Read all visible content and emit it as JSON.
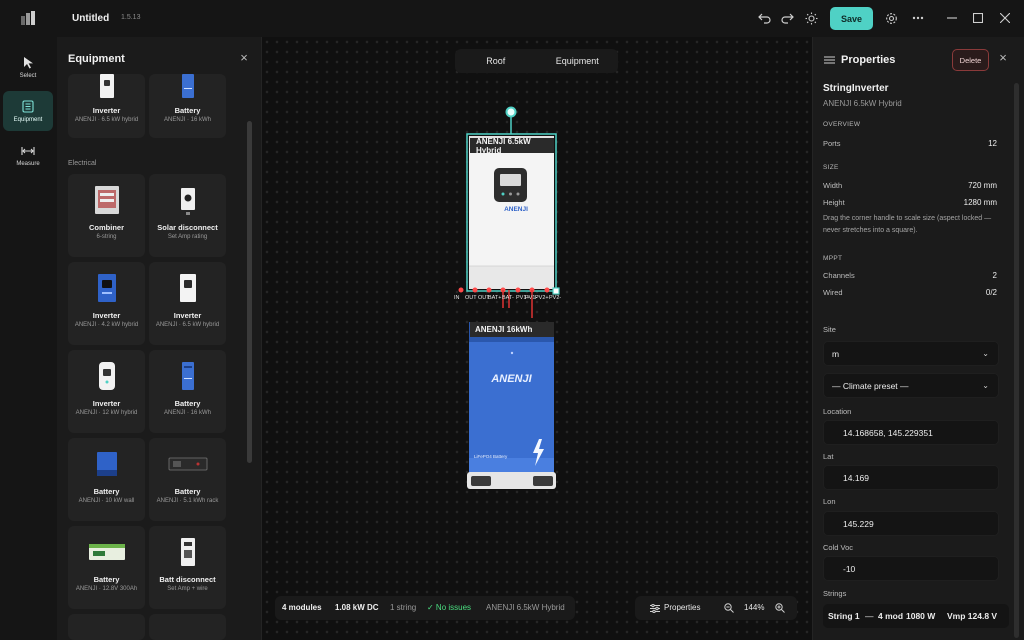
{
  "titlebar": {
    "title": "Untitled",
    "version": "1.5.13",
    "save_label": "Save"
  },
  "rail": [
    {
      "label": "Select",
      "icon": "cursor-icon"
    },
    {
      "label": "Equipment",
      "icon": "equipment-icon"
    },
    {
      "label": "Measure",
      "icon": "measure-icon"
    }
  ],
  "equipment": {
    "title": "Equipment",
    "section_electrical": "Electrical",
    "cards": [
      {
        "name": "Inverter",
        "sub": "ANENJI · 6.5 kW hybrid"
      },
      {
        "name": "Battery",
        "sub": "ANENJI · 16 kWh"
      },
      {
        "name": "Combiner",
        "sub": "6-string"
      },
      {
        "name": "Solar disconnect",
        "sub": "Set Amp rating"
      },
      {
        "name": "Inverter",
        "sub": "ANENJI · 4.2 kW hybrid"
      },
      {
        "name": "Inverter",
        "sub": "ANENJI · 6.5 kW hybrid"
      },
      {
        "name": "Inverter",
        "sub": "ANENJI · 12 kW hybrid"
      },
      {
        "name": "Battery",
        "sub": "ANENJI · 16 kWh"
      },
      {
        "name": "Battery",
        "sub": "ANENJI · 10 kW wall"
      },
      {
        "name": "Battery",
        "sub": "ANENJI · 5.1 kWh rack"
      },
      {
        "name": "Battery",
        "sub": "ANENJI · 12.8V 300Ah"
      },
      {
        "name": "Batt disconnect",
        "sub": "Set Amp + wire"
      }
    ]
  },
  "canvas": {
    "tabs": [
      "Roof",
      "Equipment"
    ],
    "inverter_label": "ANENJI 6.5kW Hybrid",
    "inverter_brand": "ANENJI",
    "battery_label": "ANENJI 16kWh",
    "battery_brand": "ANENJI",
    "battery_tag": "LiFePO4 Battery",
    "ports": [
      "IN",
      "OUT",
      "OUT",
      "BAT+",
      "BAT-",
      "PV1+",
      "PV1-",
      "PV2+",
      "PV2-"
    ],
    "status": {
      "modules": "4 modules",
      "power": "1.08 kW DC",
      "strings": "1 string",
      "issues": "✓ No issues",
      "selected": "ANENJI 6.5kW Hybrid"
    },
    "zoom": {
      "properties_label": "Properties",
      "level": "144%"
    }
  },
  "properties": {
    "title": "Properties",
    "delete_label": "Delete",
    "type": "StringInverter",
    "model": "ANENJI 6.5kW Hybrid",
    "overview_heading": "OVERVIEW",
    "ports_key": "Ports",
    "ports_val": "12",
    "size_heading": "SIZE",
    "width_key": "Width",
    "width_val": "720 mm",
    "height_key": "Height",
    "height_val": "1280 mm",
    "size_hint": "Drag the corner handle to scale size (aspect locked — never stretches into a square).",
    "mppt_heading": "MPPT",
    "channels_key": "Channels",
    "channels_val": "2",
    "wired_key": "Wired",
    "wired_val": "0/2",
    "site_label": "Site",
    "site_value": "m",
    "climate_value": "— Climate preset —",
    "location_label": "Location",
    "location_value": "14.168658, 145.229351",
    "lat_label": "Lat",
    "lat_value": "14.169",
    "lon_label": "Lon",
    "lon_value": "145.229",
    "coldvoc_label": "Cold Voc",
    "coldvoc_value": "-10",
    "strings_label": "Strings",
    "string_row": {
      "name": "String 1",
      "sep": "—",
      "mods": "4 mod",
      "watts": "1080 W",
      "vmp": "Vmp 124.8 V"
    }
  },
  "colors": {
    "accent": "#4fd1c5",
    "battery_blue": "#3b6fd1",
    "delete_border": "#8a3a3a",
    "ok_green": "#4ade80"
  }
}
